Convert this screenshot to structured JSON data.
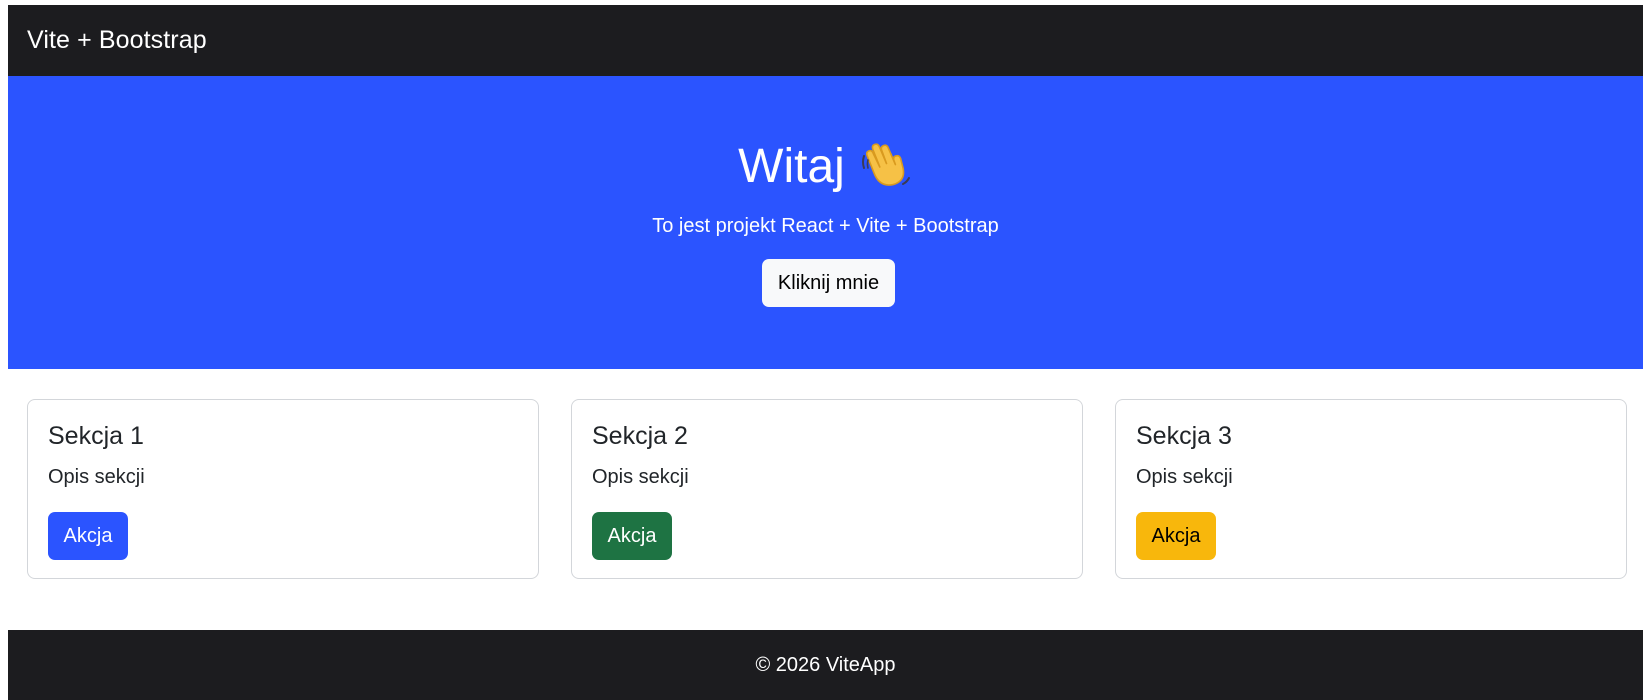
{
  "navbar": {
    "brand": "Vite + Bootstrap"
  },
  "hero": {
    "title": "Witaj",
    "title_icon": "waving-hand-icon",
    "subtitle": "To jest projekt React + Vite + Bootstrap",
    "button_label": "Kliknij mnie",
    "background_color": "#2b54ff"
  },
  "cards": [
    {
      "title": "Sekcja 1",
      "text": "Opis sekcji",
      "button_label": "Akcja",
      "button_color": "#2b54ff"
    },
    {
      "title": "Sekcja 2",
      "text": "Opis sekcji",
      "button_label": "Akcja",
      "button_color": "#1e7343"
    },
    {
      "title": "Sekcja 3",
      "text": "Opis sekcji",
      "button_label": "Akcja",
      "button_color": "#f8b70c"
    }
  ],
  "footer": {
    "text": "© 2026 ViteApp"
  },
  "colors": {
    "navbar": "#1c1c1f",
    "footer": "#1c1c1f"
  }
}
